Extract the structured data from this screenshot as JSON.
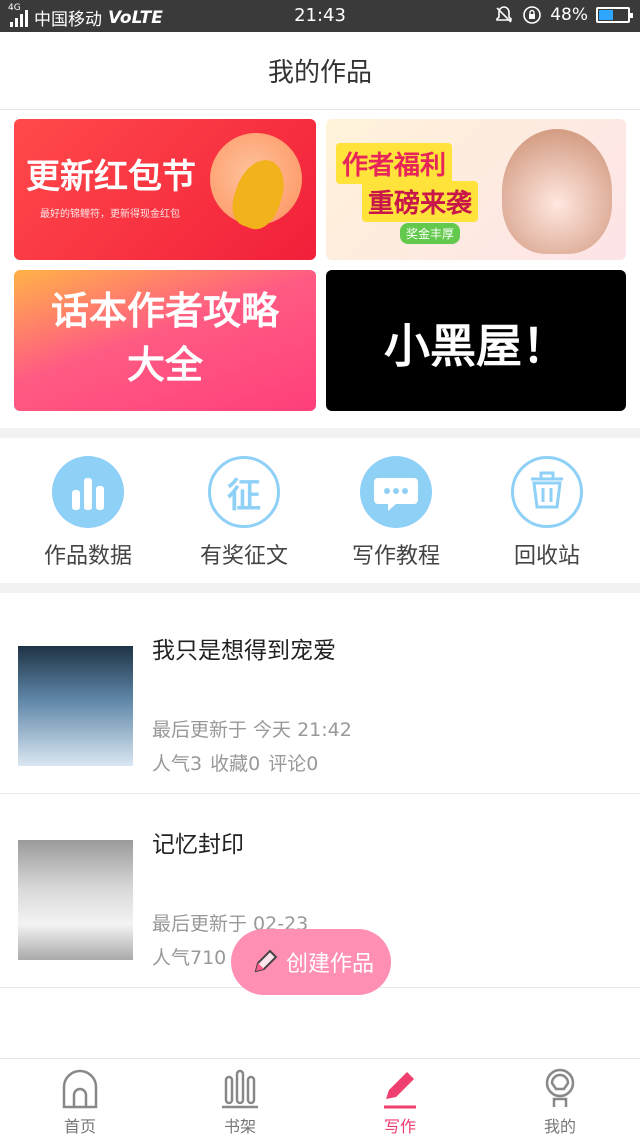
{
  "status_bar": {
    "network_type": "4G",
    "carrier": "中国移动",
    "volte": "VoLTE",
    "time": "21:43",
    "battery": "48%",
    "battery_level": 0.48
  },
  "header": {
    "title": "我的作品"
  },
  "banners": [
    {
      "title": "更新红包节",
      "subtitle": "最好的锦鲤符，更新得现金红包"
    },
    {
      "line1": "作者福利",
      "line2": "重磅来袭",
      "tag": "奖金丰厚"
    },
    {
      "line1": "话本作者攻略",
      "line2": "大全"
    },
    {
      "title": "小黑屋！"
    }
  ],
  "quick_actions": [
    {
      "label": "作品数据",
      "icon": "bar-chart-icon"
    },
    {
      "label": "有奖征文",
      "icon": "zheng-icon",
      "glyph": "征"
    },
    {
      "label": "写作教程",
      "icon": "chat-bubble-icon"
    },
    {
      "label": "回收站",
      "icon": "trash-icon"
    }
  ],
  "works": [
    {
      "title": "我只是想得到宠爱",
      "updated": "最后更新于 今天 21:42",
      "popularity": "人气3",
      "favorites": "收藏0",
      "comments": "评论0"
    },
    {
      "title": "记忆封印",
      "updated": "最后更新于 02-23",
      "popularity": "人气710"
    }
  ],
  "fab": {
    "label": "创建作品"
  },
  "tabs": [
    {
      "label": "首页",
      "icon": "home-icon"
    },
    {
      "label": "书架",
      "icon": "bookshelf-icon"
    },
    {
      "label": "写作",
      "icon": "pen-icon",
      "active": true
    },
    {
      "label": "我的",
      "icon": "profile-icon"
    }
  ],
  "colors": {
    "accent": "#ef3f6e",
    "icon_blue": "#8fd0f7",
    "fab": "#ff8fb3"
  }
}
